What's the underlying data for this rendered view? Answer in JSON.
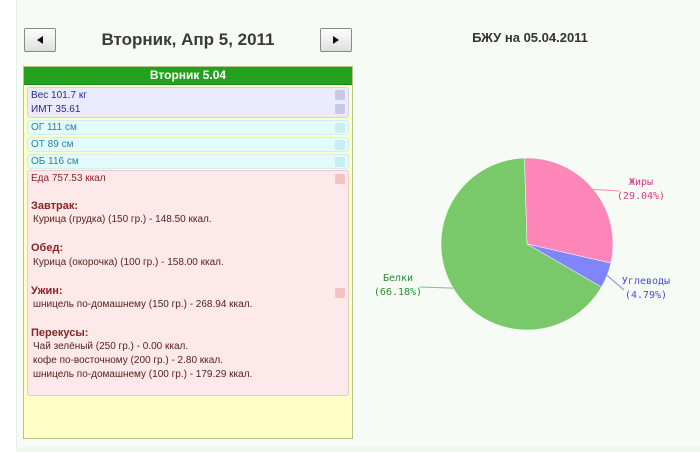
{
  "header": {
    "date_title": "Вторник, Апр 5, 2011",
    "prev_icon": "left-triangle-icon",
    "next_icon": "right-triangle-icon"
  },
  "day": {
    "header": "Вторник 5.04",
    "weight": "Вес 101.7 кг",
    "bmi": "ИМТ 35.61",
    "measurements": [
      "ОГ 111 см",
      "ОТ 89 см",
      "ОБ 116 см"
    ],
    "food": {
      "total": "Еда 757.53 ккал",
      "meals": [
        {
          "title": "Завтрак:",
          "items": [
            "Курица (грудка) (150 гр.) - 148.50 ккал."
          ]
        },
        {
          "title": "Обед:",
          "items": [
            "Курица (окорочка) (100 гр.) - 158.00 ккал."
          ]
        },
        {
          "title": "Ужин:",
          "items": [
            "шницель по-домашнему (150 гр.) - 268.94 ккал."
          ]
        },
        {
          "title": "Перекусы:",
          "items": [
            "Чай зелёный (250 гр.) - 0.00 ккал.",
            "кофе по-восточному (200 гр.) - 2.80 ккал.",
            "шницель по-домашнему (100 гр.) - 179.29 ккал."
          ]
        }
      ]
    },
    "colors": {
      "header_green": "#22a01e",
      "panel_yellow": "#ffffc6",
      "food_pink": "#fde9e9"
    }
  },
  "chart_data": {
    "type": "pie",
    "title": "БЖУ на 05.04.2011",
    "slices": [
      {
        "name": "Белки",
        "label": "(66.18%)",
        "value": 66.18,
        "color": "#79c86a",
        "label_color": "#2e8b2e"
      },
      {
        "name": "Жиры",
        "label": "(29.04%)",
        "value": 29.04,
        "color": "#ff86b8",
        "label_color": "#d23c84"
      },
      {
        "name": "Углеводы",
        "label": "(4.79%)",
        "value": 4.79,
        "color": "#7f86fb",
        "label_color": "#4a4adb"
      }
    ]
  }
}
